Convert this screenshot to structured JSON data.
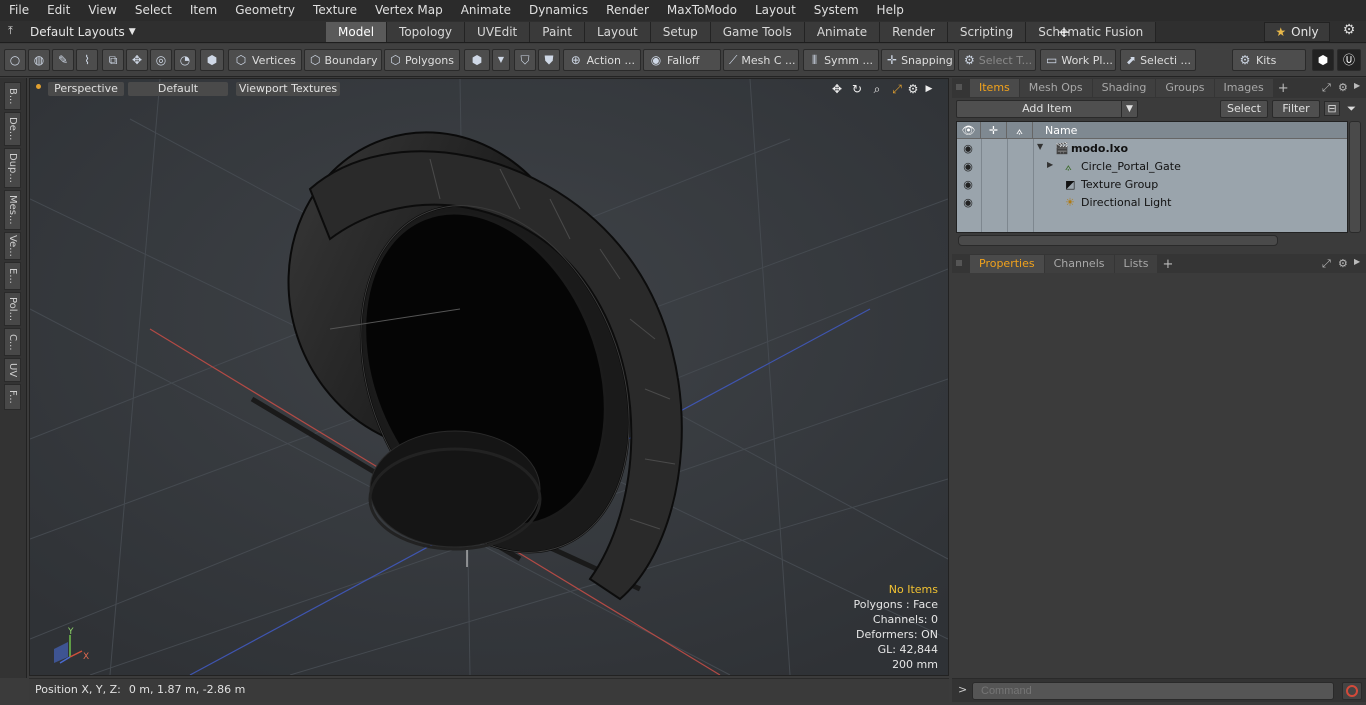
{
  "menu": [
    "File",
    "Edit",
    "View",
    "Select",
    "Item",
    "Geometry",
    "Texture",
    "Vertex Map",
    "Animate",
    "Dynamics",
    "Render",
    "MaxToModo",
    "Layout",
    "System",
    "Help"
  ],
  "layout": {
    "selector_label": "Default Layouts",
    "tabs": [
      "Model",
      "Topology",
      "UVEdit",
      "Paint",
      "Layout",
      "Setup",
      "Game Tools",
      "Animate",
      "Render",
      "Scripting",
      "Schematic Fusion"
    ],
    "active_tab": "Model",
    "only_label": "Only"
  },
  "toolbar": {
    "vertices": "Vertices",
    "boundary": "Boundary",
    "polygons": "Polygons",
    "action": "Action ...",
    "falloff": "Falloff",
    "mesh": "Mesh C ...",
    "symmetry": "Symm ...",
    "snapping": "Snapping",
    "select_t": "Select T...",
    "work_plane": "Work Pl...",
    "selection": "Selecti ...",
    "kits": "Kits"
  },
  "left_tabs": [
    "B...",
    "De...",
    "Dup...",
    "Mes...",
    "Ve...",
    "E...",
    "Pol...",
    "C...",
    "UV",
    "F..."
  ],
  "viewport": {
    "view_mode": "Perspective",
    "shading": "Default",
    "textures": "Viewport Textures",
    "info": {
      "no_items": "No Items",
      "polygons": "Polygons : Face",
      "channels": "Channels: 0",
      "deformers": "Deformers: ON",
      "gl": "GL: 42,844",
      "scale": "200 mm"
    },
    "axis_labels": {
      "x": "X",
      "y": "Y"
    }
  },
  "status": {
    "label": "Position X, Y, Z:",
    "value": "0 m, 1.87 m, -2.86 m"
  },
  "items_panel": {
    "tabs": [
      "Items",
      "Mesh Ops",
      "Shading",
      "Groups",
      "Images"
    ],
    "active_tab": "Items",
    "add_item": "Add Item",
    "select": "Select",
    "filter": "Filter",
    "column_name": "Name",
    "rows": [
      {
        "name": "modo.lxo",
        "level": 0
      },
      {
        "name": "Circle_Portal_Gate",
        "level": 1
      },
      {
        "name": "Texture Group",
        "level": 1
      },
      {
        "name": "Directional Light",
        "level": 1
      }
    ]
  },
  "properties_panel": {
    "tabs": [
      "Properties",
      "Channels",
      "Lists"
    ],
    "active_tab": "Properties"
  },
  "command": {
    "placeholder": "Command"
  },
  "colors": {
    "accent_orange": "#f1a21c",
    "info_yellow": "#f1c232",
    "viewport_bg": "#36393d",
    "grid_x_axis": "#b24a45",
    "grid_z_axis": "#3f55b0"
  }
}
